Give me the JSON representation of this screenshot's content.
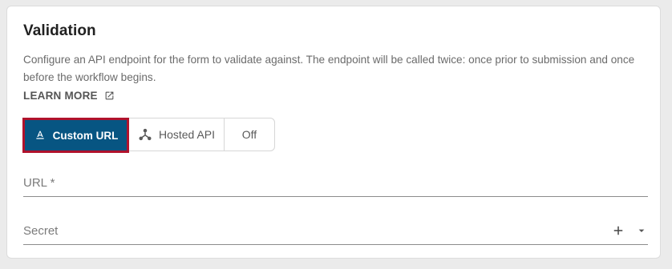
{
  "section": {
    "title": "Validation",
    "description": "Configure an API endpoint for the form to validate against. The endpoint will be called twice: once prior to submission and once before the workflow begins.",
    "learn_more_label": "LEARN MORE",
    "learn_more_icon": "external-link-icon"
  },
  "toggle": {
    "options": [
      {
        "label": "Custom URL",
        "icon": "text-format-icon",
        "selected": true
      },
      {
        "label": "Hosted API",
        "icon": "webhook-icon",
        "selected": false
      },
      {
        "label": "Off",
        "selected": false
      }
    ],
    "selected_color": "#075582",
    "highlight_color": "#b0122c"
  },
  "fields": {
    "url": {
      "label": "URL *",
      "value": ""
    },
    "secret": {
      "label": "Secret",
      "value": "",
      "add_icon": "plus-icon",
      "dropdown_icon": "caret-down-icon"
    }
  }
}
